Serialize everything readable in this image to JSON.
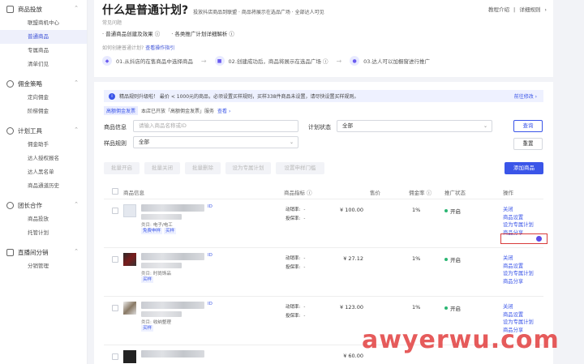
{
  "sidebar": {
    "groups": [
      {
        "label": "商品投放",
        "items": [
          "联盟商机中心",
          "普通商品",
          "专属商品",
          "清单们见"
        ]
      },
      {
        "label": "佣金策略",
        "items": [
          "定向佣金",
          "阶梯佣金"
        ]
      },
      {
        "label": "计划工具",
        "items": [
          "佣金助手",
          "达人授权报名",
          "达人黑名单",
          "商品通道历史"
        ]
      },
      {
        "label": "团长合作",
        "items": [
          "商品投放",
          "托管计划"
        ]
      },
      {
        "label": "直播间分销",
        "items": [
          "分销管理"
        ]
      }
    ],
    "active_item": "普通商品"
  },
  "header": {
    "title": "什么是普通计划?",
    "subtitle": "投放抖店商品到联盟 · 商品将展示在选品广场 · 全部达人可见",
    "links": [
      "教程介绍",
      "|",
      "详细规则",
      "›"
    ],
    "faq_label": "常见问题",
    "faq_items": [
      "· 普通商品创建及效果 ⓘ",
      "· 各类推广计划详细解析 ⓘ"
    ],
    "how_label": "如何创建普通计划?",
    "how_link": "查看操作指引",
    "steps": [
      {
        "num": "01",
        "text": "01.从抖店的在售商品中选择商品"
      },
      {
        "num": "02",
        "text": "02.创建成功后，商品将展示在选品广场 ⓘ"
      },
      {
        "num": "03",
        "text": "03.达人可以加橱窗进行推广"
      }
    ]
  },
  "notice": {
    "text": "精品规则升级啦！ 最价 < 1000元的商品，必须设置买样规则，买样338件商品未设置，请尽快设置买样规则。",
    "link": "前往修改 ›"
  },
  "tagline": {
    "tag": "高额佣金发票",
    "text": "本店已开放「高额佣金发票」服务",
    "link": "查看 ›"
  },
  "filters": {
    "product_info_label": "商品信息",
    "product_info_placeholder": "请输入商品名称或ID",
    "plan_status_label": "计划状态",
    "plan_status_value": "全部",
    "sample_rule_label": "样品规则",
    "sample_rule_value": "全部",
    "query_label": "查询",
    "reset_label": "重置"
  },
  "batch": {
    "buttons": [
      "批量开启",
      "批量关闭",
      "批量删除",
      "设为专属计划",
      "设置申样门槛"
    ],
    "add_label": "添加商品"
  },
  "table": {
    "headers": [
      "商品信息",
      "商品指标 ⓘ",
      "售价",
      "佣金率 ⓘ",
      "推广状态",
      "操作"
    ],
    "rows": [
      {
        "id_tag": "ID",
        "category": "电子/电工",
        "chips": [
          "免费申样",
          "买样"
        ],
        "metric1_label": "动销率:",
        "metric1_value": "-",
        "metric2_label": "投保率:",
        "metric2_value": "-",
        "price": "¥ 100.00",
        "rate": "1%",
        "status": "开启",
        "ops": [
          "关闭",
          "商品设置",
          "设为专属计划",
          "商品分享"
        ]
      },
      {
        "id_tag": "ID",
        "category": "时尚饰品",
        "chips": [
          "买样"
        ],
        "metric1_label": "动销率:",
        "metric1_value": "-",
        "metric2_label": "投保率:",
        "metric2_value": "-",
        "price": "¥ 27.12",
        "rate": "1%",
        "status": "开启",
        "ops": [
          "关闭",
          "商品设置",
          "设为专属计划",
          "商品分享"
        ]
      },
      {
        "id_tag": "ID",
        "category": "收纳整理",
        "chips": [
          "买样"
        ],
        "metric1_label": "动销率:",
        "metric1_value": "-",
        "metric2_label": "投保率:",
        "metric2_value": "-",
        "price": "¥ 123.00",
        "rate": "1%",
        "status": "开启",
        "ops": [
          "关闭",
          "商品设置",
          "设为专属计划",
          "商品分享"
        ]
      }
    ],
    "partial_price": "¥ 60.00"
  },
  "watermark": "awyerwu.com",
  "colors": {
    "accent": "#3a55e8",
    "highlight": "#d83a3a",
    "status_on": "#2bb673"
  }
}
